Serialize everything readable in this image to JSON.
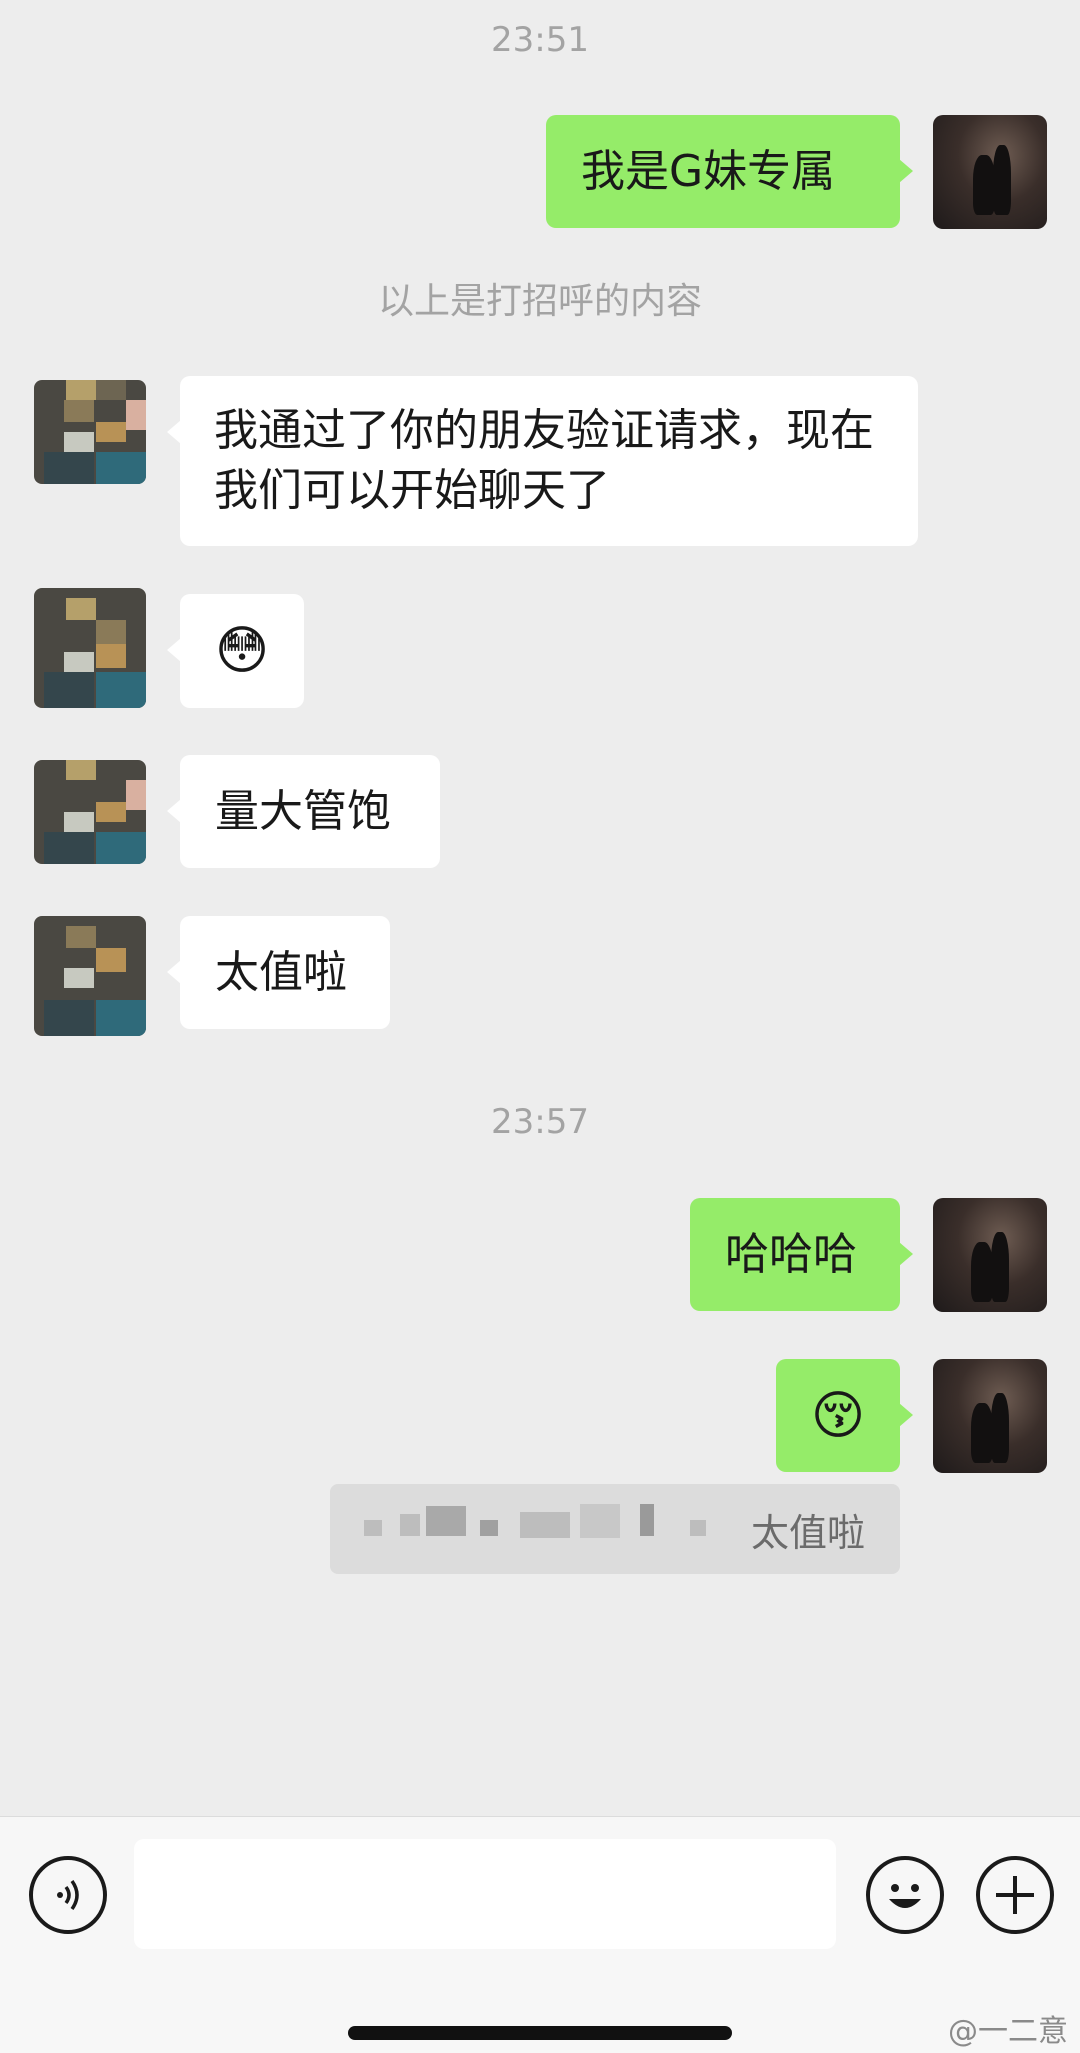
{
  "chat": {
    "timestamp_1": "23:51",
    "msg_greeting": "我是G妹专属",
    "system_note": "以上是打招呼的内容",
    "msg_accept": "我通过了你的朋友验证请求，现在我们可以开始聊天了",
    "msg_emoji_flushed": "😳",
    "msg_big_portion": "量大管饱",
    "msg_worth_it": "太值啦",
    "timestamp_2": "23:57",
    "msg_hahaha": "哈哈哈",
    "msg_emoji_kiss": "😚",
    "quote_text": "太值啦"
  },
  "input_bar": {
    "voice_icon": "voice-icon",
    "emoji_icon": "emoji-icon",
    "plus_icon": "plus-icon"
  },
  "watermark": "@一二意",
  "colors": {
    "background": "#ededed",
    "green_bubble": "#95ec69",
    "white_bubble": "#ffffff",
    "timestamp": "#a3a3a3"
  }
}
